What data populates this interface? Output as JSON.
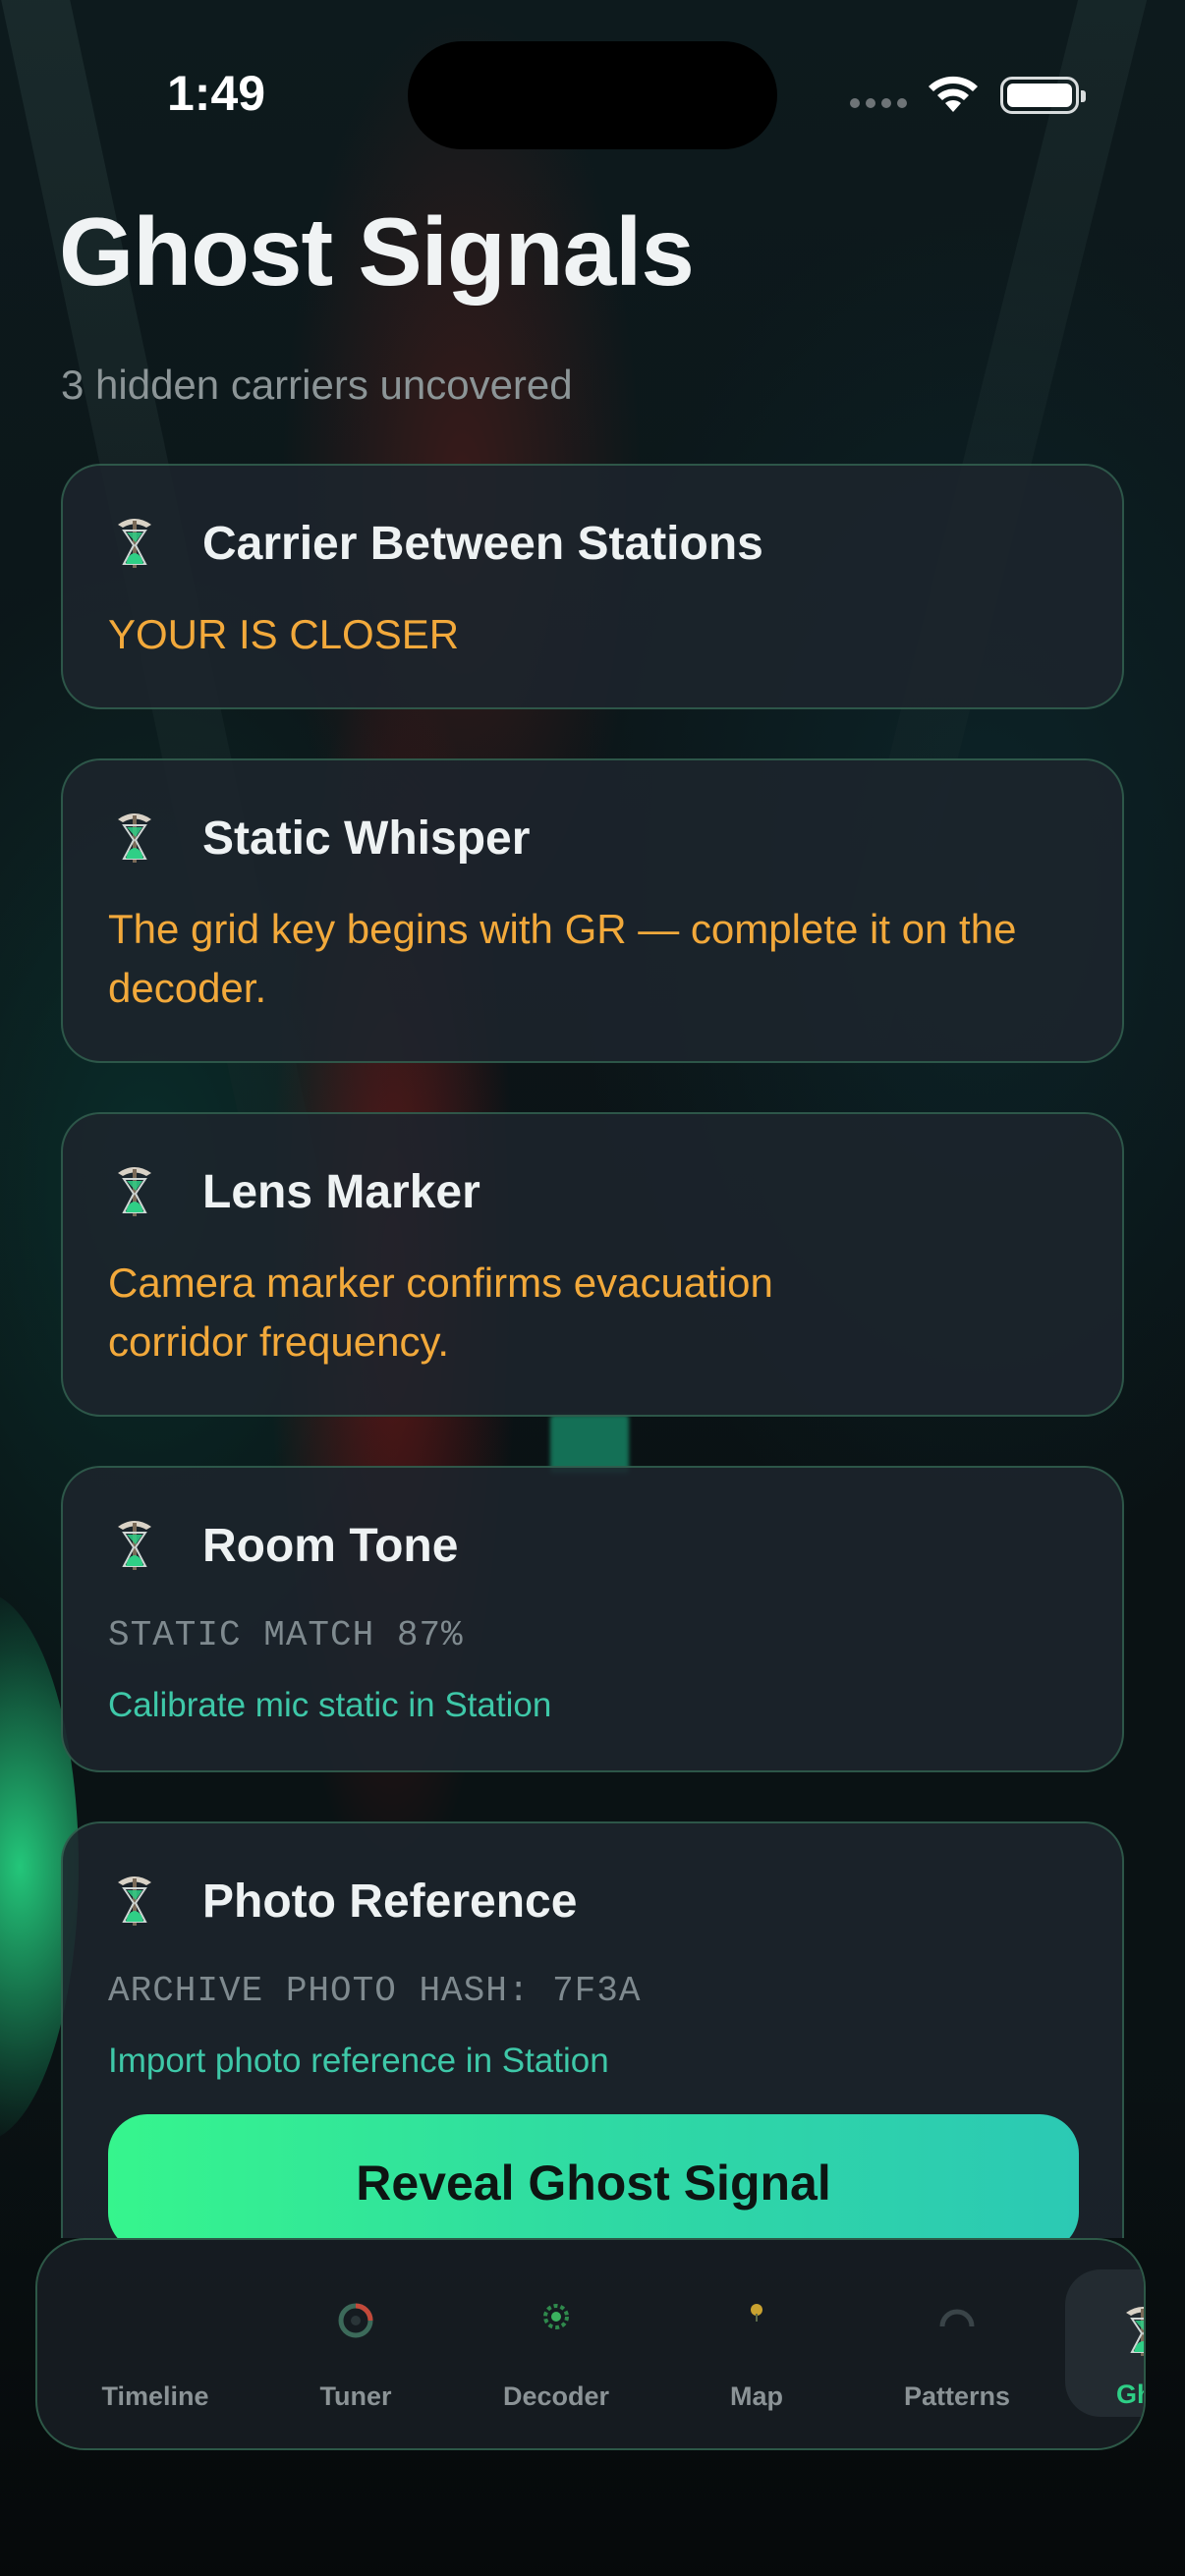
{
  "status": {
    "time": "1:49"
  },
  "header": {
    "title": "Ghost Signals",
    "subtitle": "3 hidden carriers uncovered"
  },
  "cards": [
    {
      "name": "Carrier Between Stations",
      "hint": "YOUR IS CLOSER"
    },
    {
      "name": "Static Whisper",
      "hint": "The grid key begins with GR — complete it on the decoder."
    },
    {
      "name": "Lens Marker",
      "hint_line1": "Camera marker confirms evacuation",
      "hint_line2": "corridor frequency."
    },
    {
      "name": "Room Tone",
      "mono": "STATIC MATCH 87%",
      "link": "Calibrate mic static in Station"
    },
    {
      "name": "Photo Reference",
      "mono": "ARCHIVE PHOTO HASH: 7F3A",
      "link": "Import photo reference in Station",
      "button": "Reveal Ghost Signal"
    }
  ],
  "tabs": [
    {
      "label": "Timeline"
    },
    {
      "label": "Tuner"
    },
    {
      "label": "Decoder"
    },
    {
      "label": "Map"
    },
    {
      "label": "Patterns"
    },
    {
      "label": "Ghos"
    }
  ],
  "icons": {
    "card": "hourglass-pickaxe-icon",
    "tuner": "dial-icon",
    "decoder": "gear-icon",
    "map": "pin-icon",
    "patterns": "gauge-icon"
  },
  "colors": {
    "accent": "#2ecf86",
    "hint": "#f2a93b",
    "link": "#3ec8a8"
  }
}
